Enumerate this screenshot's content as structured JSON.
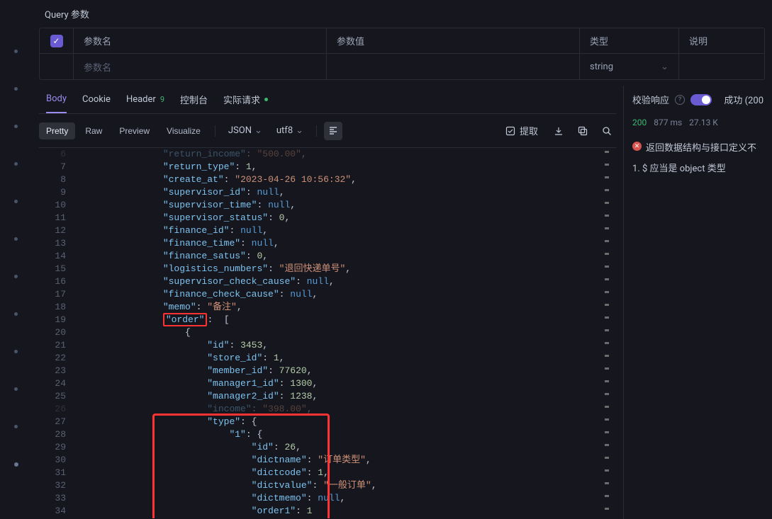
{
  "sectionTitle": "Query 参数",
  "paramsHeader": {
    "name": "参数名",
    "value": "参数值",
    "type": "类型",
    "desc": "说明"
  },
  "paramsPlaceholder": {
    "name": "参数名",
    "type": "string"
  },
  "tabs": {
    "body": "Body",
    "cookie": "Cookie",
    "header": "Header",
    "headerCount": "9",
    "console": "控制台",
    "actual": "实际请求"
  },
  "toolbar": {
    "pretty": "Pretty",
    "raw": "Raw",
    "preview": "Preview",
    "visualize": "Visualize",
    "lang": "JSON",
    "enc": "utf8",
    "extract": "提取"
  },
  "validation": {
    "label": "校验响应",
    "status": "成功 (200"
  },
  "stats": {
    "code": "200",
    "time": "877 ms",
    "size": "27.13 K"
  },
  "error": "返回数据结构与接口定义不",
  "infoLine": "1. $ 应当是 object 类型",
  "code": {
    "lines": [
      {
        "n": "6",
        "indent": 4,
        "parts": [
          {
            "t": "k",
            "v": "\"return_income\""
          },
          {
            "t": "p",
            "v": ": "
          },
          {
            "t": "s",
            "v": "\"500.00\""
          },
          {
            "t": "p",
            "v": ","
          }
        ],
        "dim": true
      },
      {
        "n": "7",
        "indent": 4,
        "parts": [
          {
            "t": "k",
            "v": "\"return_type\""
          },
          {
            "t": "p",
            "v": ": "
          },
          {
            "t": "n",
            "v": "1"
          },
          {
            "t": "p",
            "v": ","
          }
        ]
      },
      {
        "n": "8",
        "indent": 4,
        "parts": [
          {
            "t": "k",
            "v": "\"create_at\""
          },
          {
            "t": "p",
            "v": ": "
          },
          {
            "t": "s",
            "v": "\"2023-04-26 10:56:32\""
          },
          {
            "t": "p",
            "v": ","
          }
        ]
      },
      {
        "n": "9",
        "indent": 4,
        "parts": [
          {
            "t": "k",
            "v": "\"supervisor_id\""
          },
          {
            "t": "p",
            "v": ": "
          },
          {
            "t": "l",
            "v": "null"
          },
          {
            "t": "p",
            "v": ","
          }
        ]
      },
      {
        "n": "10",
        "indent": 4,
        "parts": [
          {
            "t": "k",
            "v": "\"supervisor_time\""
          },
          {
            "t": "p",
            "v": ": "
          },
          {
            "t": "l",
            "v": "null"
          },
          {
            "t": "p",
            "v": ","
          }
        ]
      },
      {
        "n": "11",
        "indent": 4,
        "parts": [
          {
            "t": "k",
            "v": "\"supervisor_status\""
          },
          {
            "t": "p",
            "v": ": "
          },
          {
            "t": "n",
            "v": "0"
          },
          {
            "t": "p",
            "v": ","
          }
        ]
      },
      {
        "n": "12",
        "indent": 4,
        "parts": [
          {
            "t": "k",
            "v": "\"finance_id\""
          },
          {
            "t": "p",
            "v": ": "
          },
          {
            "t": "l",
            "v": "null"
          },
          {
            "t": "p",
            "v": ","
          }
        ]
      },
      {
        "n": "13",
        "indent": 4,
        "parts": [
          {
            "t": "k",
            "v": "\"finance_time\""
          },
          {
            "t": "p",
            "v": ": "
          },
          {
            "t": "l",
            "v": "null"
          },
          {
            "t": "p",
            "v": ","
          }
        ]
      },
      {
        "n": "14",
        "indent": 4,
        "parts": [
          {
            "t": "k",
            "v": "\"finance_satus\""
          },
          {
            "t": "p",
            "v": ": "
          },
          {
            "t": "n",
            "v": "0"
          },
          {
            "t": "p",
            "v": ","
          }
        ]
      },
      {
        "n": "15",
        "indent": 4,
        "parts": [
          {
            "t": "k",
            "v": "\"logistics_numbers\""
          },
          {
            "t": "p",
            "v": ": "
          },
          {
            "t": "s",
            "v": "\"退回快递单号\""
          },
          {
            "t": "p",
            "v": ","
          }
        ]
      },
      {
        "n": "16",
        "indent": 4,
        "parts": [
          {
            "t": "k",
            "v": "\"supervisor_check_cause\""
          },
          {
            "t": "p",
            "v": ": "
          },
          {
            "t": "l",
            "v": "null"
          },
          {
            "t": "p",
            "v": ","
          }
        ]
      },
      {
        "n": "17",
        "indent": 4,
        "parts": [
          {
            "t": "k",
            "v": "\"finance_check_cause\""
          },
          {
            "t": "p",
            "v": ": "
          },
          {
            "t": "l",
            "v": "null"
          },
          {
            "t": "p",
            "v": ","
          }
        ]
      },
      {
        "n": "18",
        "indent": 4,
        "parts": [
          {
            "t": "k",
            "v": "\"memo\""
          },
          {
            "t": "p",
            "v": ": "
          },
          {
            "t": "s",
            "v": "\"备注\""
          },
          {
            "t": "p",
            "v": ","
          }
        ]
      },
      {
        "n": "19",
        "indent": 4,
        "parts": [
          {
            "t": "hi",
            "v": "\"order\""
          },
          {
            "t": "p",
            "v": ":  ["
          }
        ]
      },
      {
        "n": "20",
        "indent": 5,
        "parts": [
          {
            "t": "p",
            "v": "{"
          }
        ]
      },
      {
        "n": "21",
        "indent": 6,
        "parts": [
          {
            "t": "k",
            "v": "\"id\""
          },
          {
            "t": "p",
            "v": ": "
          },
          {
            "t": "n",
            "v": "3453"
          },
          {
            "t": "p",
            "v": ","
          }
        ]
      },
      {
        "n": "22",
        "indent": 6,
        "parts": [
          {
            "t": "k",
            "v": "\"store_id\""
          },
          {
            "t": "p",
            "v": ": "
          },
          {
            "t": "n",
            "v": "1"
          },
          {
            "t": "p",
            "v": ","
          }
        ]
      },
      {
        "n": "23",
        "indent": 6,
        "parts": [
          {
            "t": "k",
            "v": "\"member_id\""
          },
          {
            "t": "p",
            "v": ": "
          },
          {
            "t": "n",
            "v": "77620"
          },
          {
            "t": "p",
            "v": ","
          }
        ]
      },
      {
        "n": "24",
        "indent": 6,
        "parts": [
          {
            "t": "k",
            "v": "\"manager1_id\""
          },
          {
            "t": "p",
            "v": ": "
          },
          {
            "t": "n",
            "v": "1300"
          },
          {
            "t": "p",
            "v": ","
          }
        ]
      },
      {
        "n": "25",
        "indent": 6,
        "parts": [
          {
            "t": "k",
            "v": "\"manager2_id\""
          },
          {
            "t": "p",
            "v": ": "
          },
          {
            "t": "n",
            "v": "1238"
          },
          {
            "t": "p",
            "v": ","
          }
        ]
      },
      {
        "n": "26",
        "indent": 6,
        "parts": [
          {
            "t": "k",
            "v": "\"income\""
          },
          {
            "t": "p",
            "v": ": "
          },
          {
            "t": "s",
            "v": "\"398.00\""
          },
          {
            "t": "p",
            "v": ","
          }
        ],
        "dim": true
      },
      {
        "n": "27",
        "indent": 6,
        "parts": [
          {
            "t": "k",
            "v": "\"type\""
          },
          {
            "t": "p",
            "v": ": {"
          }
        ],
        "box": "start"
      },
      {
        "n": "28",
        "indent": 7,
        "parts": [
          {
            "t": "k",
            "v": "\"1\""
          },
          {
            "t": "p",
            "v": ": {"
          }
        ]
      },
      {
        "n": "29",
        "indent": 8,
        "parts": [
          {
            "t": "k",
            "v": "\"id\""
          },
          {
            "t": "p",
            "v": ": "
          },
          {
            "t": "n",
            "v": "26"
          },
          {
            "t": "p",
            "v": ","
          }
        ]
      },
      {
        "n": "30",
        "indent": 8,
        "parts": [
          {
            "t": "k",
            "v": "\"dictname\""
          },
          {
            "t": "p",
            "v": ": "
          },
          {
            "t": "s",
            "v": "\"订单类型\""
          },
          {
            "t": "p",
            "v": ","
          }
        ]
      },
      {
        "n": "31",
        "indent": 8,
        "parts": [
          {
            "t": "k",
            "v": "\"dictcode\""
          },
          {
            "t": "p",
            "v": ": "
          },
          {
            "t": "n",
            "v": "1"
          },
          {
            "t": "p",
            "v": ","
          }
        ]
      },
      {
        "n": "32",
        "indent": 8,
        "parts": [
          {
            "t": "k",
            "v": "\"dictvalue\""
          },
          {
            "t": "p",
            "v": ": "
          },
          {
            "t": "s",
            "v": "\"一般订单\""
          },
          {
            "t": "p",
            "v": ","
          }
        ]
      },
      {
        "n": "33",
        "indent": 8,
        "parts": [
          {
            "t": "k",
            "v": "\"dictmemo\""
          },
          {
            "t": "p",
            "v": ": "
          },
          {
            "t": "l",
            "v": "null"
          },
          {
            "t": "p",
            "v": ","
          }
        ]
      },
      {
        "n": "34",
        "indent": 8,
        "parts": [
          {
            "t": "k",
            "v": "\"order1\""
          },
          {
            "t": "p",
            "v": ": "
          },
          {
            "t": "n",
            "v": "1"
          }
        ],
        "box": "end"
      }
    ]
  }
}
